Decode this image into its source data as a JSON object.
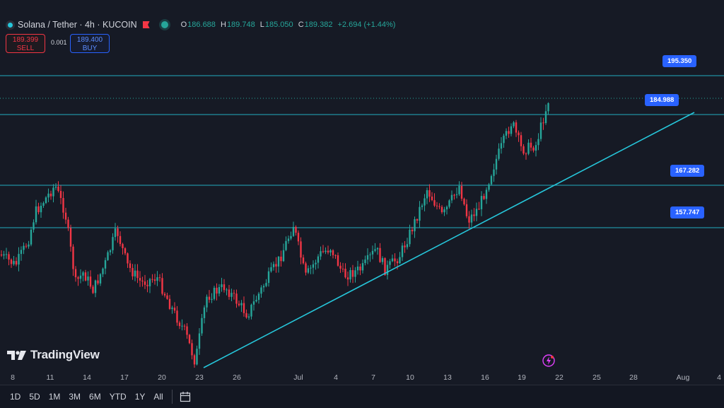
{
  "header": {
    "symbol": "Solana / Tether · 4h · KUCOIN",
    "ohlc": [
      {
        "k": "O",
        "v": "186.688"
      },
      {
        "k": "H",
        "v": "189.748"
      },
      {
        "k": "L",
        "v": "185.050"
      },
      {
        "k": "C",
        "v": "189.382"
      },
      {
        "k": "",
        "v": "+2.694 (+1.44%)"
      }
    ]
  },
  "trade": {
    "sell_price": "189.399",
    "sell_label": "SELL",
    "spread": "0.001",
    "buy_price": "189.400",
    "buy_label": "BUY"
  },
  "levels": [
    "195.350",
    "184.988",
    "167.282",
    "157.747"
  ],
  "x_axis": [
    "8",
    "11",
    "14",
    "17",
    "20",
    "23",
    "26",
    "Jul",
    "4",
    "7",
    "10",
    "13",
    "16",
    "19",
    "22",
    "25",
    "28",
    "Aug",
    "4"
  ],
  "logo": "TradingView",
  "ranges": [
    "1D",
    "5D",
    "1M",
    "3M",
    "6M",
    "YTD",
    "1Y",
    "All"
  ],
  "colors": {
    "up": "#26a69a",
    "down": "#f23645",
    "line": "#26c6da",
    "label": "#2962ff",
    "bg": "#161a25"
  },
  "icons": [
    "symbol-icon",
    "flag-icon",
    "market-open-icon",
    "calendar-icon",
    "flash-icon",
    "tradingview-logo-icon"
  ]
}
